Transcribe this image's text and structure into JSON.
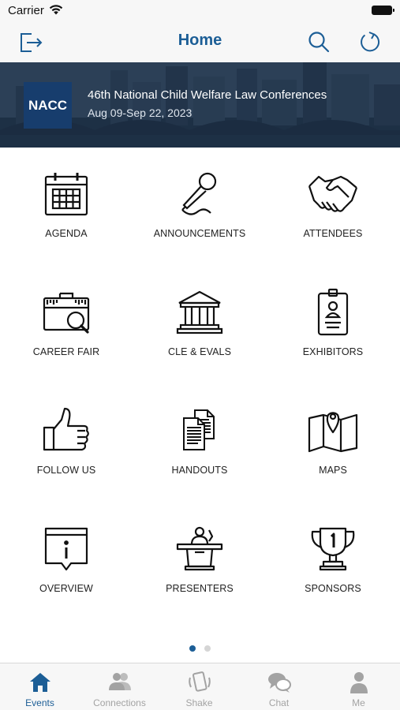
{
  "status_bar": {
    "carrier": "Carrier"
  },
  "nav": {
    "title": "Home",
    "left_icon": "exit-icon",
    "right_icons": [
      "search-icon",
      "refresh-icon"
    ],
    "accent_color": "#1c5e96"
  },
  "banner": {
    "logo_text": "NACC",
    "title": "46th National Child Welfare Law Conferences",
    "dates": "Aug 09-Sep 22, 2023"
  },
  "grid": {
    "items": [
      {
        "label": "AGENDA",
        "icon": "calendar-icon"
      },
      {
        "label": "ANNOUNCEMENTS",
        "icon": "microphone-icon"
      },
      {
        "label": "ATTENDEES",
        "icon": "handshake-icon"
      },
      {
        "label": "CAREER FAIR",
        "icon": "briefcase-search-icon"
      },
      {
        "label": "CLE & EVALS",
        "icon": "courthouse-icon"
      },
      {
        "label": "EXHIBITORS",
        "icon": "id-badge-icon"
      },
      {
        "label": "FOLLOW US",
        "icon": "thumbs-up-icon"
      },
      {
        "label": "HANDOUTS",
        "icon": "documents-icon"
      },
      {
        "label": "MAPS",
        "icon": "map-pin-icon"
      },
      {
        "label": "OVERVIEW",
        "icon": "info-icon"
      },
      {
        "label": "PRESENTERS",
        "icon": "podium-icon"
      },
      {
        "label": "SPONSORS",
        "icon": "trophy-icon"
      }
    ]
  },
  "pager": {
    "pages": 2,
    "current": 1
  },
  "tab_bar": {
    "tabs": [
      {
        "label": "Events",
        "icon": "home-icon",
        "active": true
      },
      {
        "label": "Connections",
        "icon": "people-icon",
        "active": false
      },
      {
        "label": "Shake",
        "icon": "phone-shake-icon",
        "active": false
      },
      {
        "label": "Chat",
        "icon": "chat-bubbles-icon",
        "active": false
      },
      {
        "label": "Me",
        "icon": "person-icon",
        "active": false
      }
    ],
    "active_color": "#1c5e96",
    "inactive_color": "#a3a3a3"
  }
}
